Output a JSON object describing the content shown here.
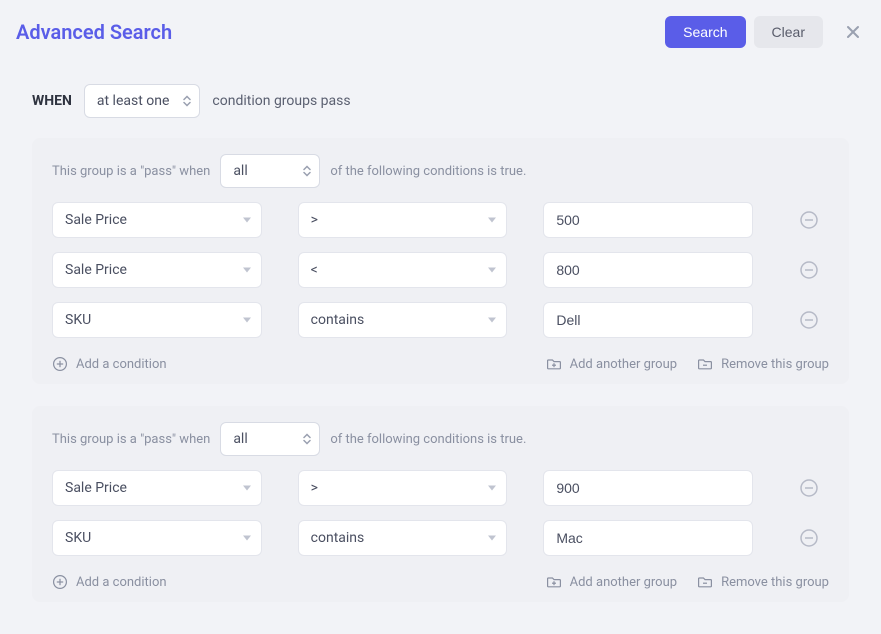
{
  "header": {
    "title": "Advanced Search",
    "search_label": "Search",
    "clear_label": "Clear"
  },
  "when": {
    "label": "WHEN",
    "mode": "at least one",
    "suffix": "condition groups pass"
  },
  "group_labels": {
    "prefix": "This group is a \"pass\" when",
    "suffix": "of the following conditions is true.",
    "add_condition": "Add a condition",
    "add_group": "Add another group",
    "remove_group": "Remove this group"
  },
  "groups": [
    {
      "match": "all",
      "conditions": [
        {
          "field": "Sale Price",
          "operator": ">",
          "value": "500"
        },
        {
          "field": "Sale Price",
          "operator": "<",
          "value": "800"
        },
        {
          "field": "SKU",
          "operator": "contains",
          "value": "Dell"
        }
      ]
    },
    {
      "match": "all",
      "conditions": [
        {
          "field": "Sale Price",
          "operator": ">",
          "value": "900"
        },
        {
          "field": "SKU",
          "operator": "contains",
          "value": "Mac"
        }
      ]
    }
  ]
}
